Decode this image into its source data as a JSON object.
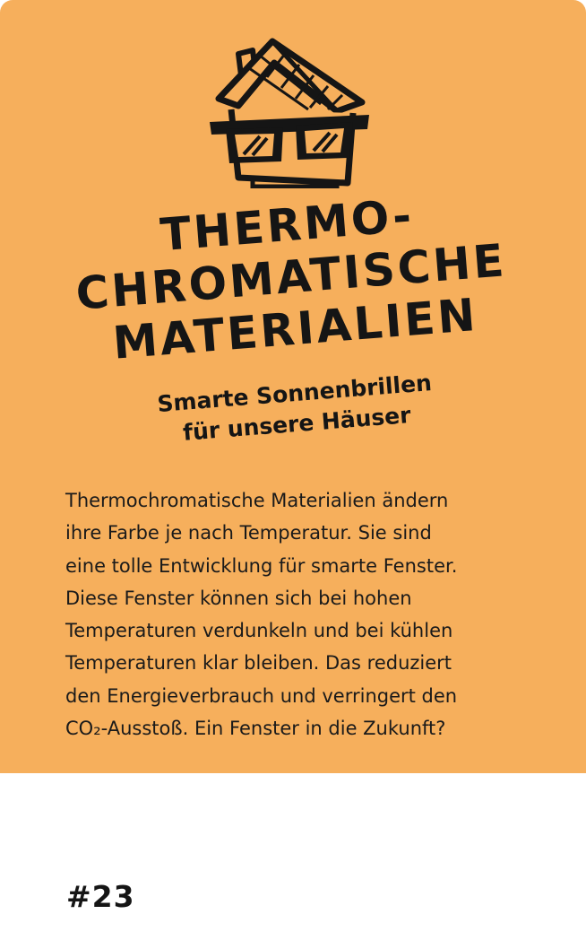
{
  "card": {
    "illustration_icon": "house-with-sunglasses-icon",
    "title_lines": [
      "THERMO-",
      "CHROMATISCHE",
      "MATERIALIEN"
    ],
    "subtitle_lines": [
      "Smarte Sonnenbrillen",
      "für unsere Häuser"
    ],
    "body_lines": [
      "Thermochromatische Materialien ändern",
      "ihre Farbe je nach Temperatur. Sie sind",
      "eine tolle Entwicklung für smarte Fenster.",
      "Diese Fenster können sich bei hohen",
      "Temperaturen verdunkeln und bei kühlen",
      "Temperaturen klar bleiben. Das reduziert",
      "den Energieverbrauch und verringert den",
      "CO₂-Ausstoß. Ein Fenster in die Zukunft?"
    ],
    "number": "#23",
    "colors": {
      "panel": "#f6af5c",
      "ink": "#151515",
      "background": "#ffffff"
    }
  }
}
